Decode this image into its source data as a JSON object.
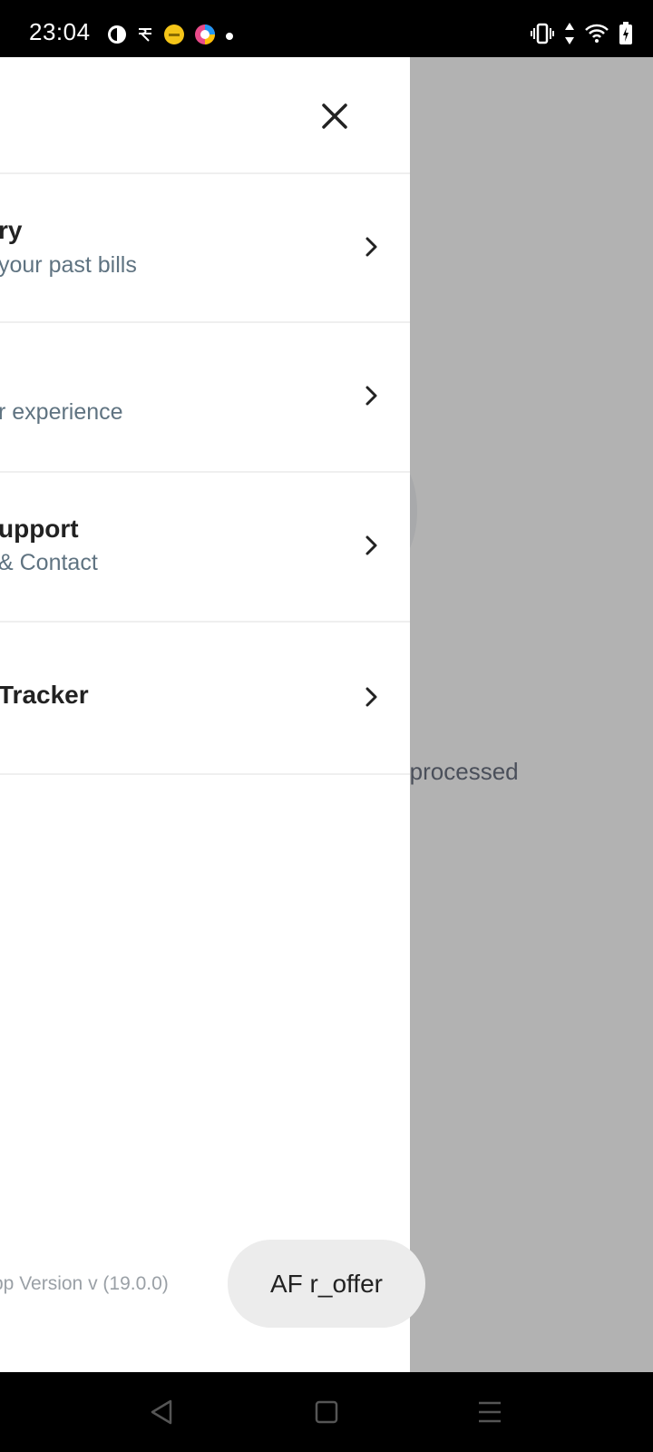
{
  "status_bar": {
    "time": "23:04",
    "left_icons": [
      "app-notification-icon",
      "rupee-app-icon",
      "emoji-app-icon",
      "colorful-app-icon",
      "dot-icon"
    ],
    "right_icons": [
      "vibrate-icon",
      "data-arrows-icon",
      "wifi-icon",
      "battery-charging-icon"
    ]
  },
  "drawer": {
    "items": [
      {
        "title": "ry",
        "subtitle": "your past bills"
      },
      {
        "title": "",
        "subtitle": "r experience"
      },
      {
        "title": "upport",
        "subtitle": "& Contact"
      },
      {
        "title": " Tracker",
        "subtitle": ""
      }
    ],
    "version": "pp Version v (19.0.0)"
  },
  "background": {
    "partial_text": "e processed"
  },
  "toast": {
    "label": "AF r_offer"
  },
  "nav_bar": {
    "icons": [
      "back-icon",
      "home-icon",
      "recents-icon"
    ]
  },
  "colors": {
    "overlay": "#b2b2b2",
    "drawer_bg": "#ffffff",
    "subtitle": "#5f7381",
    "title": "#222222",
    "divider": "#efefef"
  }
}
